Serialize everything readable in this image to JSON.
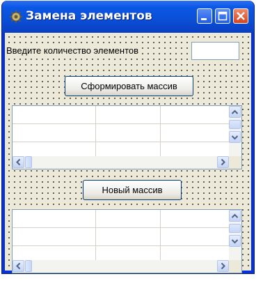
{
  "window": {
    "title": "Замена элементов",
    "icon": "app-icon"
  },
  "form": {
    "count_label": "Введите количество элементов",
    "count_value": "",
    "build_button": "Сформировать массив",
    "new_button": "Новый массив"
  },
  "colors": {
    "titlebar": "#0a4fd6",
    "face": "#ece9d8",
    "close": "#d9441d"
  }
}
